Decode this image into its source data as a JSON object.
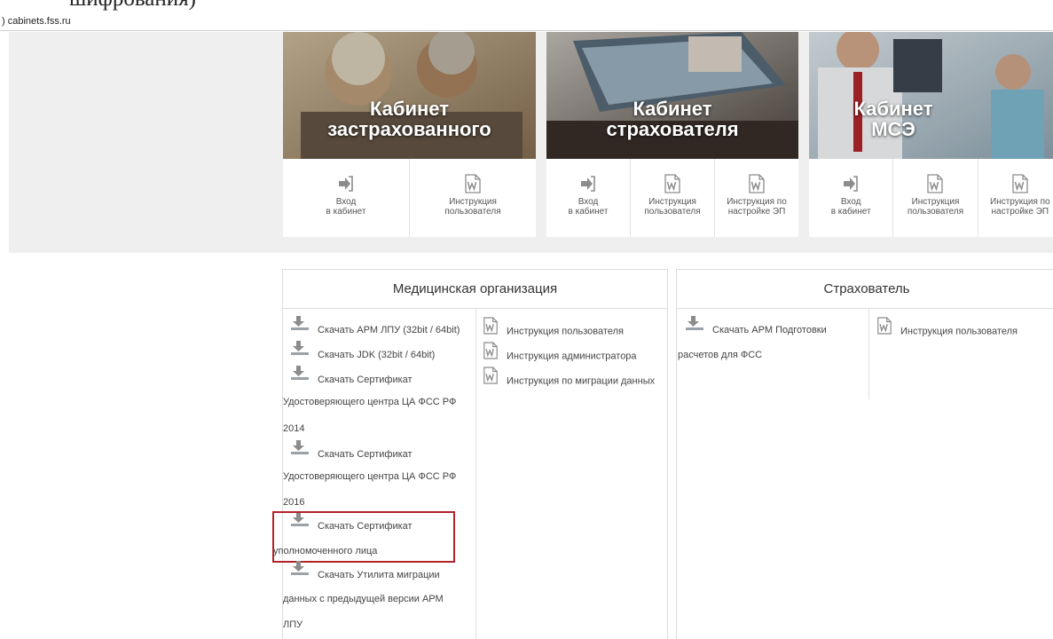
{
  "page": {
    "doc_fragment": "шифрования)",
    "url_prefix": ")",
    "url": "cabinets.fss.ru"
  },
  "cards": [
    {
      "title_line1": "Кабинет",
      "title_line2": "застрахованного",
      "links": [
        {
          "icon": "login-arrow-icon",
          "line1": "Вход",
          "line2": "в кабинет"
        },
        {
          "icon": "word-document-icon",
          "line1": "Инструкция",
          "line2": "пользователя"
        }
      ]
    },
    {
      "title_line1": "Кабинет",
      "title_line2": "страхователя",
      "links": [
        {
          "icon": "login-arrow-icon",
          "line1": "Вход",
          "line2": "в кабинет"
        },
        {
          "icon": "word-document-icon",
          "line1": "Инструкция",
          "line2": "пользователя"
        },
        {
          "icon": "word-document-icon",
          "line1": "Инструкция по",
          "line2": "настройке ЭП"
        }
      ]
    },
    {
      "title_line1": "Кабинет",
      "title_line2": "МСЭ",
      "links": [
        {
          "icon": "login-arrow-icon",
          "line1": "Вход",
          "line2": "в кабинет"
        },
        {
          "icon": "word-document-icon",
          "line1": "Инструкция",
          "line2": "пользователя"
        },
        {
          "icon": "word-document-icon",
          "line1": "Инструкция по",
          "line2": "настройке ЭП"
        }
      ]
    }
  ],
  "medical": {
    "heading": "Медицинская организация",
    "downloads": [
      {
        "label": "Скачать АРМ ЛПУ (32bit / 64bit)"
      },
      {
        "label": "Скачать JDK (32bit / 64bit)"
      },
      {
        "label": "Скачать Сертификат",
        "cont1": "Удостоверяющего центра ЦА ФСС РФ",
        "cont2": "2014"
      },
      {
        "label": "Скачать Сертификат",
        "cont1": "Удостоверяющего центра ЦА ФСС РФ",
        "cont2": "2016"
      },
      {
        "label": "Скачать Сертификат",
        "cont1": "уполномоченного лица"
      },
      {
        "label": "Скачать Утилита миграции",
        "cont1": "данных с предыдущей версии АРМ",
        "cont2": "ЛПУ"
      }
    ],
    "docs": [
      {
        "label": "Инструкция пользователя"
      },
      {
        "label": "Инструкция администратора"
      },
      {
        "label": "Инструкция по миграции данных"
      }
    ]
  },
  "insurer": {
    "heading": "Страхователь",
    "download": {
      "label": "Скачать АРМ Подготовки",
      "cont1": "расчетов для ФСС"
    },
    "doc": {
      "label": "Инструкция пользователя"
    }
  },
  "colors": {
    "band": "#efefef",
    "border": "#dcdcdc",
    "highlight": "#b3222a",
    "icon_gray": "#8c8c8c"
  }
}
